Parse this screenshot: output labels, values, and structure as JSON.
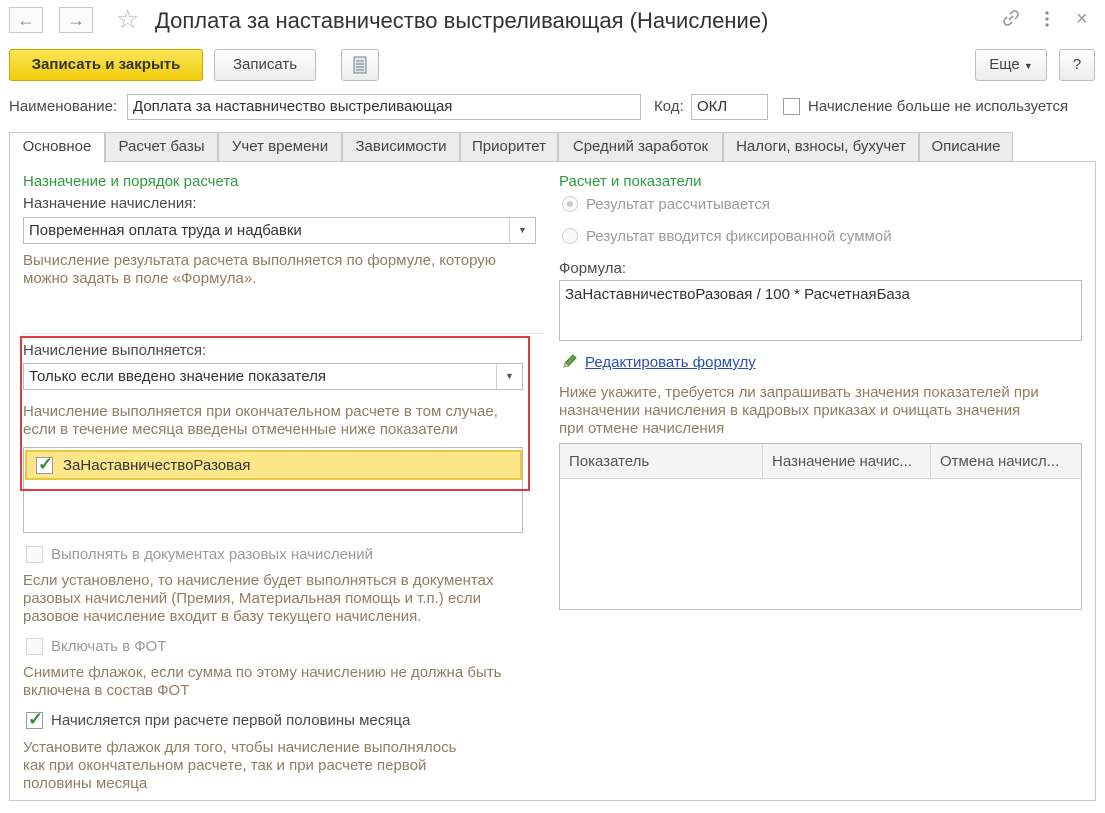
{
  "window": {
    "title": "Доплата за наставничество выстреливающая (Начисление)",
    "back_icon": "arrow-left-icon",
    "forward_icon": "arrow-right-icon",
    "favorite_icon": "star-icon",
    "link_icon": "link-icon",
    "more_icon": "more-vertical-icon",
    "close_icon": "close-icon"
  },
  "toolbar": {
    "save_close_label": "Записать и закрыть",
    "save_label": "Записать",
    "more_label": "Еще",
    "help_label": "?"
  },
  "header_fields": {
    "name_label": "Наименование:",
    "name_value": "Доплата за наставничество выстреливающая",
    "code_label": "Код:",
    "code_value": "ОКЛ",
    "not_used_label": "Начисление больше не используется",
    "not_used_checked": false
  },
  "tabs": [
    {
      "label": "Основное",
      "active": true
    },
    {
      "label": "Расчет базы"
    },
    {
      "label": "Учет времени"
    },
    {
      "label": "Зависимости"
    },
    {
      "label": "Приоритет"
    },
    {
      "label": "Средний заработок"
    },
    {
      "label": "Налоги, взносы, бухучет"
    },
    {
      "label": "Описание"
    }
  ],
  "left": {
    "section_title": "Назначение и порядок расчета",
    "purpose_label": "Назначение начисления:",
    "purpose_value": "Повременная оплата труда и надбавки",
    "purpose_hint_1": "Вычисление результата расчета выполняется по формуле, которую",
    "purpose_hint_2": "можно задать в поле «Формула».",
    "execution_label": "Начисление выполняется:",
    "execution_value": "Только если введено значение показателя",
    "execution_hint_1": "Начисление выполняется при окончательном расчете в том случае,",
    "execution_hint_2": "если в течение месяца введены отмеченные ниже показатели",
    "indicator_item": "ЗаНаставничествоРазовая",
    "one_time_docs_label": "Выполнять в документах разовых начислений",
    "one_time_hint_1": "Если установлено, то начисление будет выполняться в документах",
    "one_time_hint_2": "разовых начислений (Премия, Материальная помощь и т.п.) если",
    "one_time_hint_3": "разовое начисление входит в базу текущего начисления.",
    "fot_label": "Включать в ФОТ",
    "fot_hint_1": "Снимите флажок, если сумма по этому начислению не должна быть",
    "fot_hint_2": "включена в состав ФОТ",
    "first_half_label": "Начисляется при расчете первой половины месяца",
    "first_half_hint_1": "Установите флажок для того, чтобы начисление выполнялось",
    "first_half_hint_2": "как при окончательном расчете, так и при расчете первой",
    "first_half_hint_3": "половины месяца"
  },
  "right": {
    "section_title": "Расчет и показатели",
    "radio_calculated": "Результат рассчитывается",
    "radio_fixed": "Результат вводится фиксированной суммой",
    "formula_label": "Формула:",
    "formula_value": "ЗаНаставничествоРазовая / 100 * РасчетнаяБаза",
    "edit_formula_link": "Редактировать формулу",
    "edit_icon": "pencil-icon",
    "indicators_hint_1": "Ниже укажите, требуется ли запрашивать значения показателей при",
    "indicators_hint_2": "назначении начисления в кадровых приказах и очищать значения",
    "indicators_hint_3": "при отмене начисления",
    "table_columns": [
      "Показатель",
      "Назначение начис...",
      "Отмена начисл..."
    ]
  },
  "colors": {
    "primary_button": "#f4d11b",
    "section_green": "#2e9b3e",
    "hint_brown": "#8e7e62",
    "highlight_red": "#e0393e",
    "selected_row": "#fbe68a"
  }
}
